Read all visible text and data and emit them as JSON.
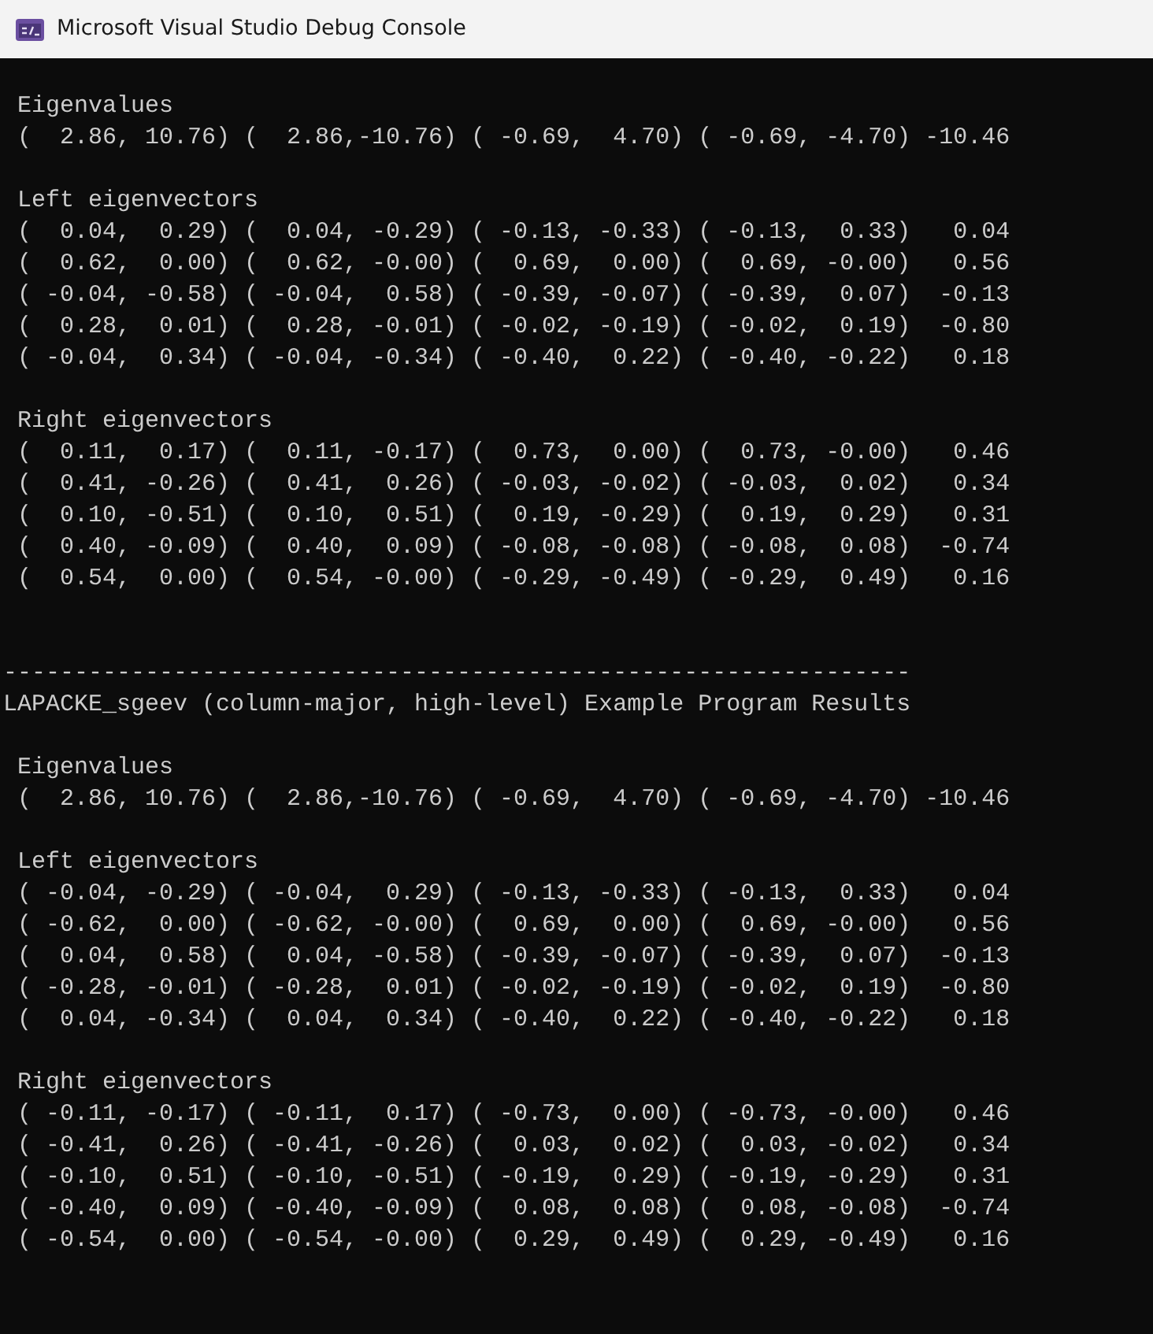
{
  "window": {
    "title": "Microsoft Visual Studio Debug Console"
  },
  "console": {
    "lines": [
      {
        "kind": "blank"
      },
      {
        "kind": "text",
        "text": " Eigenvalues"
      },
      {
        "kind": "text",
        "text": " (  2.86, 10.76) (  2.86,-10.76) ( -0.69,  4.70) ( -0.69, -4.70) -10.46"
      },
      {
        "kind": "blank"
      },
      {
        "kind": "text",
        "text": " Left eigenvectors"
      },
      {
        "kind": "text",
        "text": " (  0.04,  0.29) (  0.04, -0.29) ( -0.13, -0.33) ( -0.13,  0.33)   0.04"
      },
      {
        "kind": "text",
        "text": " (  0.62,  0.00) (  0.62, -0.00) (  0.69,  0.00) (  0.69, -0.00)   0.56"
      },
      {
        "kind": "text",
        "text": " ( -0.04, -0.58) ( -0.04,  0.58) ( -0.39, -0.07) ( -0.39,  0.07)  -0.13"
      },
      {
        "kind": "text",
        "text": " (  0.28,  0.01) (  0.28, -0.01) ( -0.02, -0.19) ( -0.02,  0.19)  -0.80"
      },
      {
        "kind": "text",
        "text": " ( -0.04,  0.34) ( -0.04, -0.34) ( -0.40,  0.22) ( -0.40, -0.22)   0.18"
      },
      {
        "kind": "blank"
      },
      {
        "kind": "text",
        "text": " Right eigenvectors"
      },
      {
        "kind": "text",
        "text": " (  0.11,  0.17) (  0.11, -0.17) (  0.73,  0.00) (  0.73, -0.00)   0.46"
      },
      {
        "kind": "text",
        "text": " (  0.41, -0.26) (  0.41,  0.26) ( -0.03, -0.02) ( -0.03,  0.02)   0.34"
      },
      {
        "kind": "text",
        "text": " (  0.10, -0.51) (  0.10,  0.51) (  0.19, -0.29) (  0.19,  0.29)   0.31"
      },
      {
        "kind": "text",
        "text": " (  0.40, -0.09) (  0.40,  0.09) ( -0.08, -0.08) ( -0.08,  0.08)  -0.74"
      },
      {
        "kind": "text",
        "text": " (  0.54,  0.00) (  0.54, -0.00) ( -0.29, -0.49) ( -0.29,  0.49)   0.16"
      },
      {
        "kind": "blank"
      },
      {
        "kind": "blank"
      },
      {
        "kind": "text",
        "text": "----------------------------------------------------------------"
      },
      {
        "kind": "text",
        "text": "LAPACKE_sgeev (column-major, high-level) Example Program Results"
      },
      {
        "kind": "blank"
      },
      {
        "kind": "text",
        "text": " Eigenvalues"
      },
      {
        "kind": "text",
        "text": " (  2.86, 10.76) (  2.86,-10.76) ( -0.69,  4.70) ( -0.69, -4.70) -10.46"
      },
      {
        "kind": "blank"
      },
      {
        "kind": "text",
        "text": " Left eigenvectors"
      },
      {
        "kind": "text",
        "text": " ( -0.04, -0.29) ( -0.04,  0.29) ( -0.13, -0.33) ( -0.13,  0.33)   0.04"
      },
      {
        "kind": "text",
        "text": " ( -0.62,  0.00) ( -0.62, -0.00) (  0.69,  0.00) (  0.69, -0.00)   0.56"
      },
      {
        "kind": "text",
        "text": " (  0.04,  0.58) (  0.04, -0.58) ( -0.39, -0.07) ( -0.39,  0.07)  -0.13"
      },
      {
        "kind": "text",
        "text": " ( -0.28, -0.01) ( -0.28,  0.01) ( -0.02, -0.19) ( -0.02,  0.19)  -0.80"
      },
      {
        "kind": "text",
        "text": " (  0.04, -0.34) (  0.04,  0.34) ( -0.40,  0.22) ( -0.40, -0.22)   0.18"
      },
      {
        "kind": "blank"
      },
      {
        "kind": "text",
        "text": " Right eigenvectors"
      },
      {
        "kind": "text",
        "text": " ( -0.11, -0.17) ( -0.11,  0.17) ( -0.73,  0.00) ( -0.73, -0.00)   0.46"
      },
      {
        "kind": "text",
        "text": " ( -0.41,  0.26) ( -0.41, -0.26) (  0.03,  0.02) (  0.03, -0.02)   0.34"
      },
      {
        "kind": "text",
        "text": " ( -0.10,  0.51) ( -0.10, -0.51) ( -0.19,  0.29) ( -0.19, -0.29)   0.31"
      },
      {
        "kind": "text",
        "text": " ( -0.40,  0.09) ( -0.40, -0.09) (  0.08,  0.08) (  0.08, -0.08)  -0.74"
      },
      {
        "kind": "text",
        "text": " ( -0.54,  0.00) ( -0.54, -0.00) (  0.29,  0.49) (  0.29, -0.49)   0.16"
      }
    ]
  }
}
